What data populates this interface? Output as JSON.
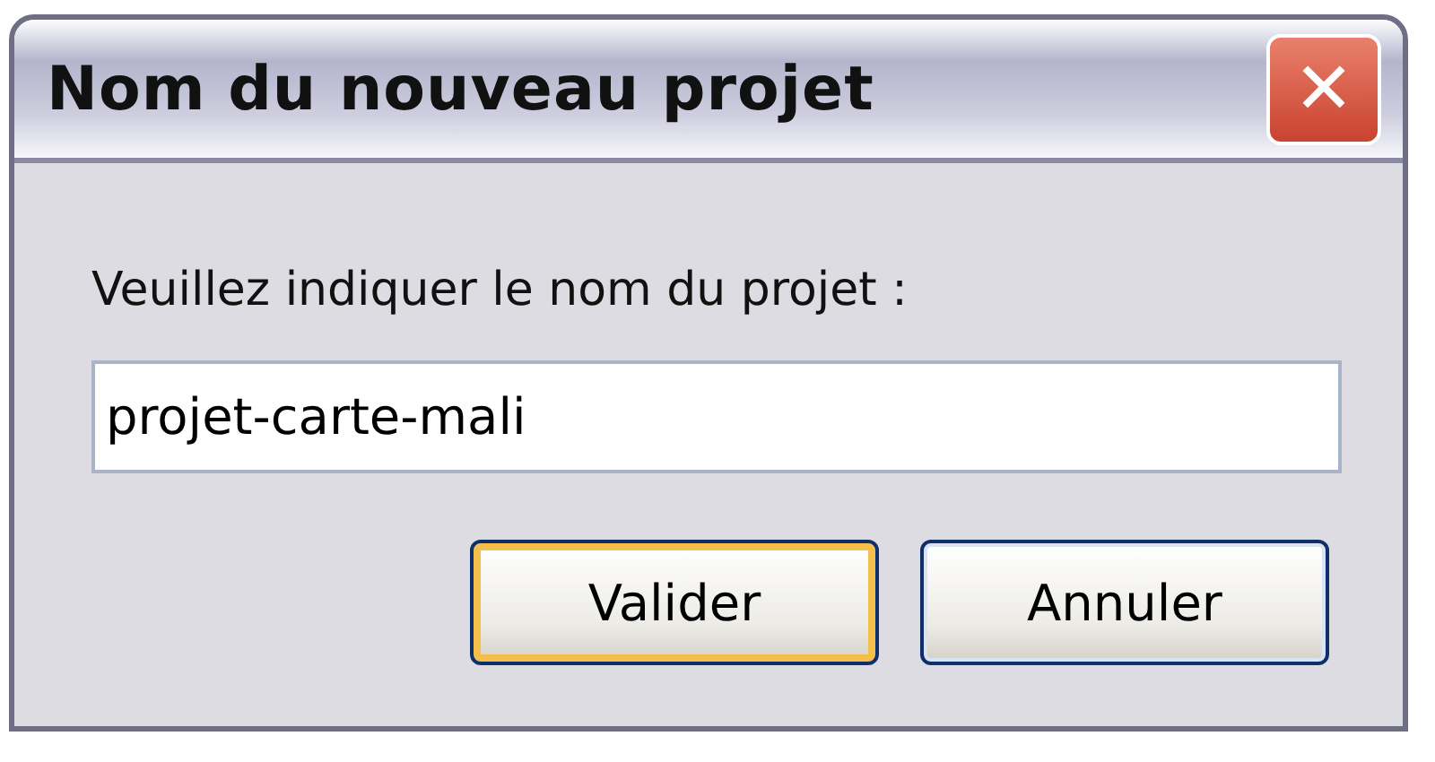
{
  "window": {
    "title": "Nom du nouveau projet",
    "close": "✕"
  },
  "prompt": "Veuillez indiquer le nom du projet :",
  "name_field": {
    "value": "projet-carte-mali"
  },
  "buttons": [
    {
      "label": "Valider",
      "default": true
    },
    {
      "label": "Annuler",
      "default": false
    }
  ]
}
